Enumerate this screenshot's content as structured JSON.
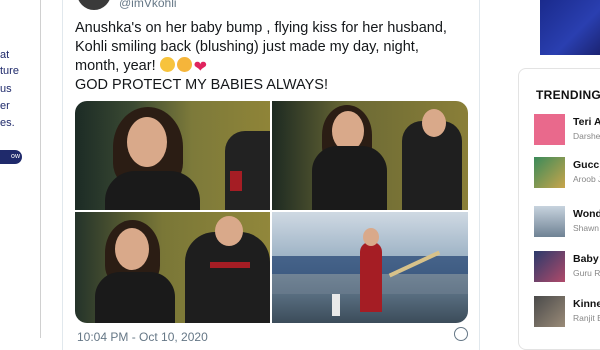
{
  "left_promo": {
    "lines": [
      "at",
      "ture",
      "us",
      "er",
      "es."
    ],
    "cta": "ow"
  },
  "tweet": {
    "handle": "@imVkohli",
    "text_line1": "Anushka's on her baby bump , flying kiss for her husband,",
    "text_line2": "Kohli smiling back (blushing)  just made my day, night,",
    "text_line3": "month, year!",
    "text_line4": "GOD PROTECT MY BABIES ALWAYS!",
    "emojis": [
      "smiling-face-emoji",
      "smiling-face-with-hearts-emoji",
      "red-heart-emoji"
    ],
    "timestamp": "10:04 PM - Oct 10, 2020"
  },
  "trending": {
    "title": "TRENDING",
    "items": [
      {
        "title": "Teri A",
        "sub": "Darshe",
        "color": "#e9698c"
      },
      {
        "title": "Gucci",
        "sub": "Aroob J",
        "color": "#3a8a5a"
      },
      {
        "title": "Wond",
        "sub": "Shawn",
        "color": "#8fa3b8"
      },
      {
        "title": "Baby G",
        "sub": "Guru R",
        "color": "#2b3a6b"
      },
      {
        "title": "Kinne",
        "sub": "Ranjit E",
        "color": "#4a4a4a"
      }
    ]
  },
  "colors": {
    "promo_navy": "#1f2a6b",
    "banner_blue": "#2a3fb0",
    "heart_red": "#e0245e"
  }
}
